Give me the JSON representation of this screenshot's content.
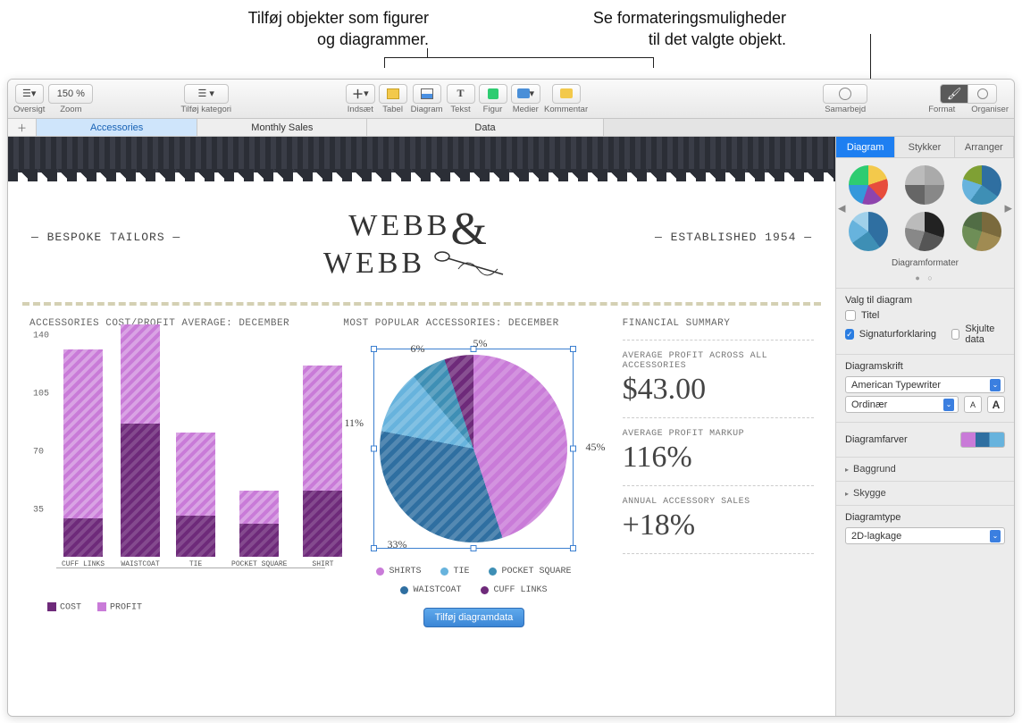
{
  "callouts": {
    "left_line1": "Tilføj objekter som figurer",
    "left_line2": "og diagrammer.",
    "right_line1": "Se formateringsmuligheder",
    "right_line2": "til det valgte objekt."
  },
  "toolbar": {
    "oversigt": "Oversigt",
    "zoom_value": "150 %",
    "zoom_label": "Zoom",
    "kategori": "Tilføj kategori",
    "indsaet": "Indsæt",
    "tabel": "Tabel",
    "diagram": "Diagram",
    "tekst": "Tekst",
    "figur": "Figur",
    "medier": "Medier",
    "kommentar": "Kommentar",
    "samarbejd": "Samarbejd",
    "format": "Format",
    "organiser": "Organiser"
  },
  "tabs": {
    "t1": "Accessories",
    "t2": "Monthly Sales",
    "t3": "Data"
  },
  "canvas": {
    "tag_left": "— BESPOKE TAILORS —",
    "tag_right": "— ESTABLISHED 1954 —",
    "logo_line1": "WEBB",
    "logo_line2": "WEBB",
    "bar_title": "ACCESSORIES COST/PROFIT AVERAGE: DECEMBER",
    "pie_title": "MOST POPULAR ACCESSORIES: DECEMBER",
    "summary_title": "FINANCIAL SUMMARY",
    "summary": {
      "l1": "AVERAGE PROFIT ACROSS ALL ACCESSORIES",
      "v1": "$43.00",
      "l2": "AVERAGE PROFIT MARKUP",
      "v2": "116%",
      "l3": "ANNUAL ACCESSORY SALES",
      "v3": "+18%"
    },
    "bar_legend": {
      "cost": "COST",
      "profit": "PROFIT"
    },
    "pie_legend": {
      "shirts": "SHIRTS",
      "tie": "TIE",
      "pocket": "POCKET SQUARE",
      "waist": "WAISTCOAT",
      "cuff": "CUFF LINKS"
    },
    "pie_labels": {
      "p45": "45%",
      "p33": "33%",
      "p11": "11%",
      "p6": "6%",
      "p5": "5%"
    },
    "data_btn": "Tilføj diagramdata"
  },
  "chart_data": [
    {
      "type": "bar",
      "title": "ACCESSORIES COST/PROFIT AVERAGE: DECEMBER",
      "categories": [
        "CUFF LINKS",
        "WAISTCOAT",
        "TIE",
        "POCKET SQUARE",
        "SHIRT"
      ],
      "series": [
        {
          "name": "COST",
          "values": [
            23,
            80,
            25,
            20,
            40
          ],
          "color": "#6e2a7a"
        },
        {
          "name": "PROFIT",
          "values": [
            125,
            140,
            75,
            40,
            115
          ],
          "color": "#c97bd8"
        }
      ],
      "stacked": true,
      "ylim": [
        0,
        140
      ],
      "yticks": [
        0,
        35,
        70,
        105,
        140
      ]
    },
    {
      "type": "pie",
      "title": "MOST POPULAR ACCESSORIES: DECEMBER",
      "categories": [
        "SHIRTS",
        "WAISTCOAT",
        "TIE",
        "POCKET SQUARE",
        "CUFF LINKS"
      ],
      "values": [
        45,
        33,
        11,
        6,
        5
      ],
      "colors": [
        "#c97bd8",
        "#2f6fa1",
        "#67b3dd",
        "#3e8fb5",
        "#6e2a7a"
      ]
    }
  ],
  "sidebar": {
    "tabs": {
      "diagram": "Diagram",
      "stykker": "Stykker",
      "arranger": "Arranger"
    },
    "styles_caption": "Diagramformater",
    "opts_header": "Valg til diagram",
    "opt_titel": "Titel",
    "opt_legend": "Signaturforklaring",
    "opt_hidden": "Skjulte data",
    "font_header": "Diagramskrift",
    "font_name": "American Typewriter",
    "font_style": "Ordinær",
    "colors_header": "Diagramfarver",
    "bg_header": "Baggrund",
    "shadow_header": "Skygge",
    "type_header": "Diagramtype",
    "type_value": "2D-lagkage"
  }
}
